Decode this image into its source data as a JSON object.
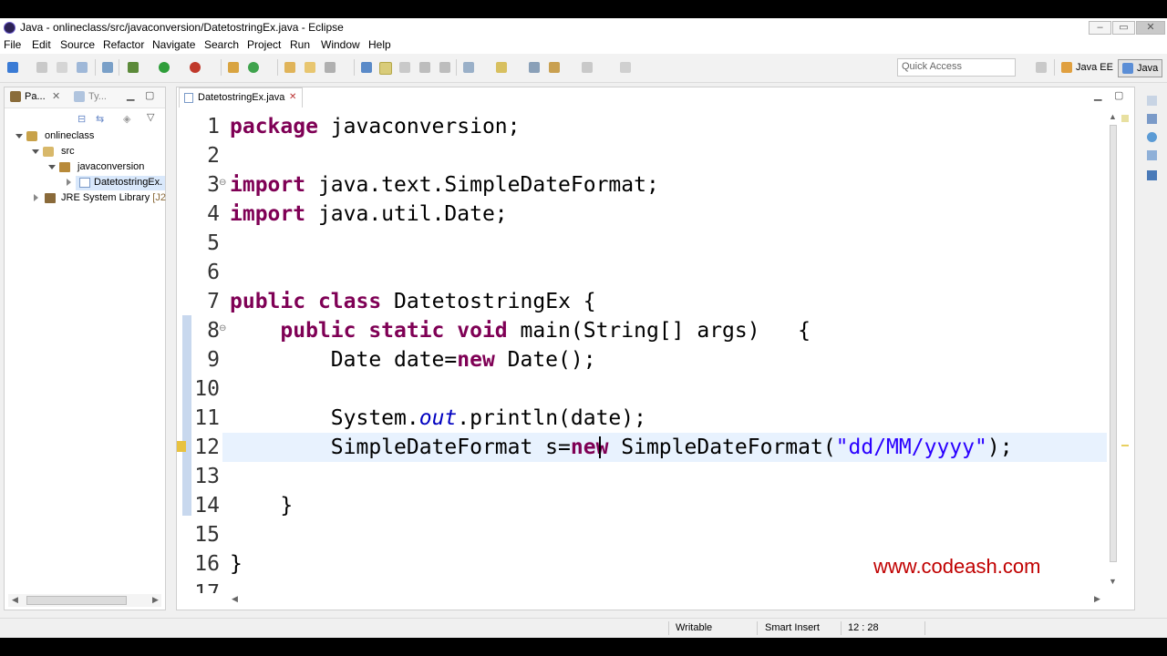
{
  "window": {
    "title": "Java - onlineclass/src/javaconversion/DatetostringEx.java - Eclipse"
  },
  "menu": [
    "File",
    "Edit",
    "Source",
    "Refactor",
    "Navigate",
    "Search",
    "Project",
    "Run",
    "Window",
    "Help"
  ],
  "toolbar": {
    "quick_access_placeholder": "Quick Access",
    "perspective_javaee": "Java EE",
    "perspective_java": "Java"
  },
  "package_explorer": {
    "tab_label": "Pa...",
    "tab2_label": "Ty...",
    "tree": [
      {
        "label": "onlineclass"
      },
      {
        "label": "src"
      },
      {
        "label": "javaconversion"
      },
      {
        "label": "DatetostringEx."
      },
      {
        "label": "JRE System Library",
        "suffix": "[J2"
      }
    ]
  },
  "editor": {
    "tab_label": "DatetostringEx.java",
    "line_numbers": [
      "1",
      "2",
      "3",
      "4",
      "5",
      "6",
      "7",
      "8",
      "9",
      "10",
      "11",
      "12",
      "13",
      "14",
      "15",
      "16",
      "17"
    ],
    "code": {
      "l1_kw": "package",
      "l1_rest": " javaconversion;",
      "l3_kw": "import",
      "l3_rest": " java.text.SimpleDateFormat;",
      "l4_kw": "import",
      "l4_rest": " java.util.Date;",
      "l7_kw1": "public",
      "l7_kw2": "class",
      "l7_rest": " DatetostringEx {",
      "l8_kw": "    public static void",
      "l8_rest": " main(String[] args)   {",
      "l9_a": "        Date date=",
      "l9_kw": "new",
      "l9_b": " Date();",
      "l11_a": "        System.",
      "l11_it": "out",
      "l11_b": ".println(date);",
      "l12_a": "        SimpleDateFormat s=",
      "l12_kw": "new",
      "l12_b": " SimpleDateFormat(",
      "l12_str": "\"dd/MM/yyyy\"",
      "l12_c": ");",
      "l14": "    }",
      "l16": "}"
    },
    "watermark": "www.codeash.com"
  },
  "status": {
    "writable": "Writable",
    "insert_mode": "Smart Insert",
    "position": "12 : 28"
  }
}
